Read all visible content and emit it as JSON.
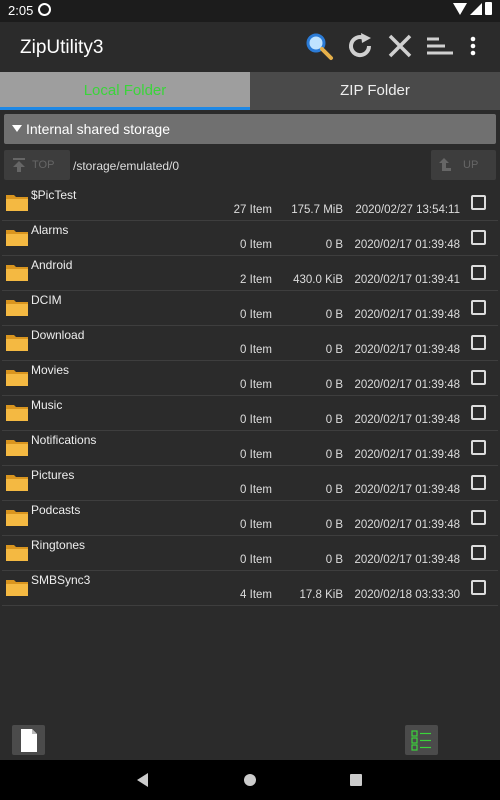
{
  "status_bar": {
    "time": "2:05"
  },
  "app_bar": {
    "title": "ZipUtility3"
  },
  "tabs": [
    {
      "label": "Local Folder",
      "active": true
    },
    {
      "label": "ZIP Folder",
      "active": false
    }
  ],
  "storage": {
    "label": "Internal shared storage"
  },
  "path_bar": {
    "top_label": "TOP",
    "path": "/storage/emulated/0",
    "up_label": "UP"
  },
  "files": [
    {
      "name": "$PicTest",
      "count": "27 Item",
      "size": "175.7 MiB",
      "date": "2020/02/27 13:54:11"
    },
    {
      "name": "Alarms",
      "count": "0 Item",
      "size": "0 B",
      "date": "2020/02/17 01:39:48"
    },
    {
      "name": "Android",
      "count": "2 Item",
      "size": "430.0 KiB",
      "date": "2020/02/17 01:39:41"
    },
    {
      "name": "DCIM",
      "count": "0 Item",
      "size": "0 B",
      "date": "2020/02/17 01:39:48"
    },
    {
      "name": "Download",
      "count": "0 Item",
      "size": "0 B",
      "date": "2020/02/17 01:39:48"
    },
    {
      "name": "Movies",
      "count": "0 Item",
      "size": "0 B",
      "date": "2020/02/17 01:39:48"
    },
    {
      "name": "Music",
      "count": "0 Item",
      "size": "0 B",
      "date": "2020/02/17 01:39:48"
    },
    {
      "name": "Notifications",
      "count": "0 Item",
      "size": "0 B",
      "date": "2020/02/17 01:39:48"
    },
    {
      "name": "Pictures",
      "count": "0 Item",
      "size": "0 B",
      "date": "2020/02/17 01:39:48"
    },
    {
      "name": "Podcasts",
      "count": "0 Item",
      "size": "0 B",
      "date": "2020/02/17 01:39:48"
    },
    {
      "name": "Ringtones",
      "count": "0 Item",
      "size": "0 B",
      "date": "2020/02/17 01:39:48"
    },
    {
      "name": "SMBSync3",
      "count": "4 Item",
      "size": "17.8 KiB",
      "date": "2020/02/18 03:33:30"
    }
  ],
  "colors": {
    "active_tab_text": "#3bd43b",
    "active_tab_indicator": "#1e88e5",
    "folder": "#f0b429"
  },
  "icons": {
    "toolbar": [
      "search-icon",
      "refresh-icon",
      "close-icon",
      "sort-icon",
      "more-vert-icon"
    ],
    "bottom": [
      "new-file-icon",
      "select-all-icon"
    ]
  }
}
